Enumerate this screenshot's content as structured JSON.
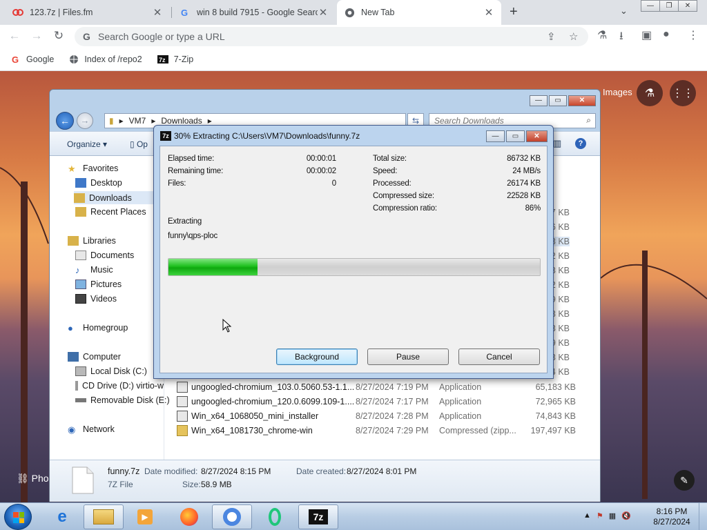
{
  "browser": {
    "tabs": [
      {
        "title": "123.7z | Files.fm",
        "icon": "filesfm-icon"
      },
      {
        "title": "win 8 build 7915 - Google Search",
        "icon": "google-icon"
      },
      {
        "title": "New Tab",
        "icon": "chrome-icon"
      }
    ],
    "omnibox_placeholder": "Search Google or type a URL",
    "bookmarks": [
      {
        "label": "Google",
        "icon": "google-icon"
      },
      {
        "label": "Index of /repo2",
        "icon": "globe-icon"
      },
      {
        "label": "7-Zip",
        "icon": "7zip-icon"
      }
    ]
  },
  "newtab": {
    "images_link": "Images",
    "photo_credit": "Pho"
  },
  "explorer": {
    "breadcrumb": [
      "VM7",
      "Downloads"
    ],
    "search_placeholder": "Search Downloads",
    "organize": "Organize ▾",
    "open": "Op",
    "nav": {
      "favorites": "Favorites",
      "desktop": "Desktop",
      "downloads": "Downloads",
      "recent": "Recent Places",
      "libraries": "Libraries",
      "documents": "Documents",
      "music": "Music",
      "pictures": "Pictures",
      "videos": "Videos",
      "homegroup": "Homegroup",
      "computer": "Computer",
      "local_disk": "Local Disk (C:)",
      "cd_drive": "CD Drive (D:) virtio-w",
      "removable": "Removable Disk (E:)",
      "network": "Network"
    },
    "hidden_sizes": [
      "7 KB",
      "6 KB",
      "3 KB",
      "2 KB",
      "3 KB",
      "2 KB",
      "9 KB",
      "3 KB",
      "3 KB",
      "9 KB",
      "3 KB",
      "4 KB"
    ],
    "files": [
      {
        "name": "ungoogled-chromium_103.0.5060.53-1.1...",
        "date": "8/27/2024 7:19 PM",
        "type": "Application",
        "size": "65,183 KB"
      },
      {
        "name": "ungoogled-chromium_120.0.6099.109-1....",
        "date": "8/27/2024 7:17 PM",
        "type": "Application",
        "size": "72,965 KB"
      },
      {
        "name": "Win_x64_1068050_mini_installer",
        "date": "8/27/2024 7:28 PM",
        "type": "Application",
        "size": "74,843 KB"
      },
      {
        "name": "Win_x64_1081730_chrome-win",
        "date": "8/27/2024 7:29 PM",
        "type": "Compressed (zipp...",
        "size": "197,497 KB"
      }
    ],
    "details": {
      "filename": "funny.7z",
      "filetype": "7Z File",
      "modified_label": "Date modified:",
      "modified": "8/27/2024 8:15 PM",
      "created_label": "Date created:",
      "created": "8/27/2024 8:01 PM",
      "size_label": "Size:",
      "size": "58.9 MB"
    }
  },
  "sevenzip": {
    "title": "30% Extracting C:\\Users\\VM7\\Downloads\\funny.7z",
    "progress_percent": 24,
    "left": [
      {
        "label": "Elapsed time:",
        "value": "00:00:01"
      },
      {
        "label": "Remaining time:",
        "value": "00:00:02"
      },
      {
        "label": "Files:",
        "value": "0"
      }
    ],
    "right": [
      {
        "label": "Total size:",
        "value": "86732 KB"
      },
      {
        "label": "Speed:",
        "value": "24 MB/s"
      },
      {
        "label": "Processed:",
        "value": "26174 KB"
      },
      {
        "label": "Compressed size:",
        "value": "22528 KB"
      },
      {
        "label": "Compression ratio:",
        "value": "86%"
      }
    ],
    "status": "Extracting",
    "current_file": "funny\\qps-ploc",
    "buttons": {
      "background": "Background",
      "pause": "Pause",
      "cancel": "Cancel"
    }
  },
  "taskbar": {
    "time": "8:16 PM",
    "date": "8/27/2024"
  },
  "colors": {
    "progress": "#1fc01f",
    "accent": "#1a73e8"
  }
}
